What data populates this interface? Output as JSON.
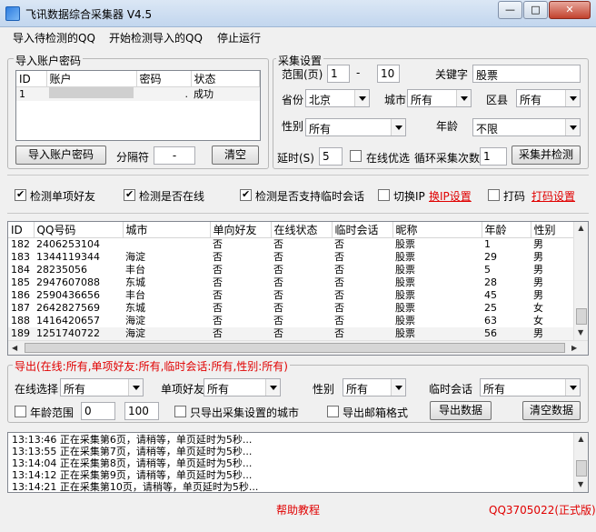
{
  "window": {
    "title": "飞讯数据综合采集器 V4.5",
    "min": "—",
    "max": "□",
    "close": "✕"
  },
  "menu": [
    "导入待检测的QQ",
    "开始检测导入的QQ",
    "停止运行"
  ],
  "import_group": {
    "legend": "导入账户密码",
    "headers": [
      "ID",
      "账户",
      "密码",
      "状态"
    ],
    "rows": [
      {
        "id": "1",
        "account": "",
        "password": ".",
        "status": "成功"
      }
    ],
    "import_btn": "导入账户密码",
    "sep_label": "分隔符",
    "sep_value": "-",
    "clear_btn": "清空"
  },
  "collect": {
    "legend": "采集设置",
    "range_label": "范围(页)",
    "range_from": "1",
    "range_dash": "-",
    "range_to": "10",
    "keyword_label": "关键字",
    "keyword": "股票",
    "province_label": "省份",
    "province": "北京",
    "city_label": "城市",
    "city": "所有",
    "district_label": "区县",
    "district": "所有",
    "gender_label": "性别",
    "gender": "所有",
    "age_label": "年龄",
    "age": "不限",
    "delay_label": "延时(S)",
    "delay": "5",
    "online_pref": "在线优选",
    "loop_label": "循环采集次数",
    "loop": "1",
    "collect_btn": "采集并检测"
  },
  "options": {
    "single_friend": "检测单项好友",
    "online": "检测是否在线",
    "temp_chat": "检测是否支持临时会话",
    "switch_ip": "切换IP",
    "ip_link": "换IP设置",
    "captcha": "打码",
    "captcha_link": "打码设置"
  },
  "results": {
    "headers": [
      "ID",
      "QQ号码",
      "城市",
      "单向好友",
      "在线状态",
      "临时会话",
      "昵称",
      "年龄",
      "性别"
    ],
    "rows": [
      [
        "182",
        "2406253104",
        "",
        "否",
        "否",
        "否",
        "股票",
        "1",
        "男"
      ],
      [
        "183",
        "1344119344",
        "海淀",
        "否",
        "否",
        "否",
        "股票",
        "29",
        "男"
      ],
      [
        "184",
        "28235056",
        "丰台",
        "否",
        "否",
        "否",
        "股票",
        "5",
        "男"
      ],
      [
        "185",
        "2947607088",
        "东城",
        "否",
        "否",
        "否",
        "股票",
        "28",
        "男"
      ],
      [
        "186",
        "2590436656",
        "丰台",
        "否",
        "否",
        "否",
        "股票",
        "45",
        "男"
      ],
      [
        "187",
        "2642827569",
        "东城",
        "否",
        "否",
        "否",
        "股票",
        "25",
        "女"
      ],
      [
        "188",
        "1416420657",
        "海淀",
        "否",
        "否",
        "否",
        "股票",
        "63",
        "女"
      ],
      [
        "189",
        "1251740722",
        "海淀",
        "否",
        "否",
        "否",
        "股票",
        "56",
        "男"
      ]
    ]
  },
  "export": {
    "legend": "导出(在线:所有,单项好友:所有,临时会话:所有,性别:所有)",
    "online_label": "在线选择",
    "online": "所有",
    "single_label": "单项好友",
    "single": "所有",
    "gender_label": "性别",
    "gender": "所有",
    "temp_label": "临时会话",
    "temp": "所有",
    "age_range": "年龄范围",
    "age_from": "0",
    "age_to": "100",
    "only_city": "只导出采集设置的城市",
    "mail_fmt": "导出邮箱格式",
    "export_btn": "导出数据",
    "clear_btn": "清空数据"
  },
  "log": [
    "13:13:46 正在采集第6页，请稍等，单页延时为5秒...",
    "13:13:55 正在采集第7页，请稍等，单页延时为5秒...",
    "13:14:04 正在采集第8页，请稍等，单页延时为5秒...",
    "13:14:12 正在采集第9页，请稍等，单页延时为5秒...",
    "13:14:21 正在采集第10页，请稍等，单页延时为5秒..."
  ],
  "footer": {
    "help": "帮助教程",
    "qq": "QQ3705022(正式版)"
  },
  "colors": {
    "accent": "#e00000",
    "title_bg": "#c2d6ee"
  }
}
